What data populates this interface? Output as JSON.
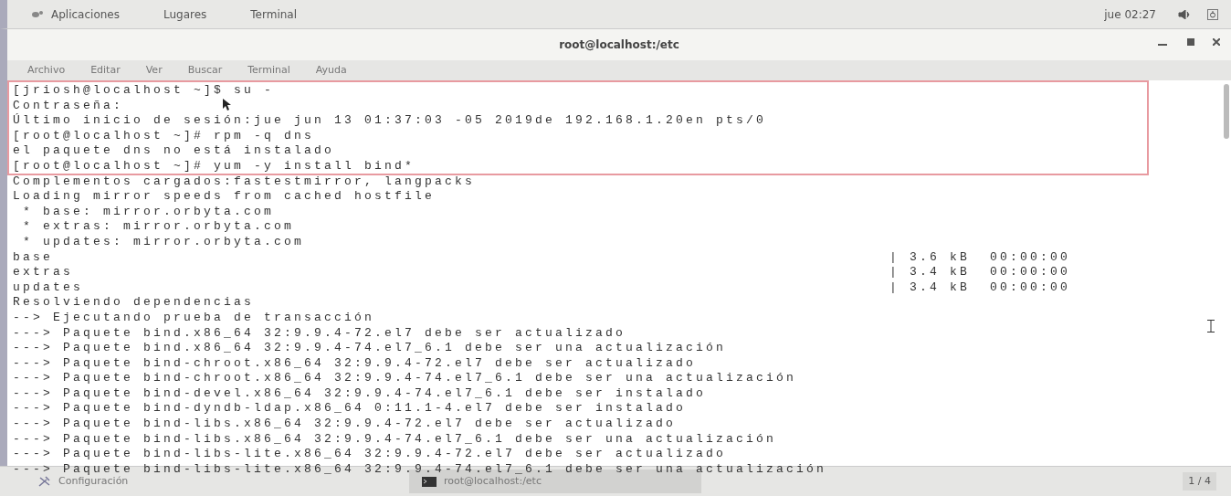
{
  "top_bar": {
    "menus": [
      "Aplicaciones",
      "Lugares",
      "Terminal"
    ],
    "clock": "jue 02:27"
  },
  "window": {
    "title": "root@localhost:/etc"
  },
  "menu_bar": [
    "Archivo",
    "Editar",
    "Ver",
    "Buscar",
    "Terminal",
    "Ayuda"
  ],
  "terminal": {
    "lines": [
      {
        "kind": "text",
        "text": "[jriosh@localhost ~]$ su -"
      },
      {
        "kind": "text",
        "text": "Contraseña:"
      },
      {
        "kind": "text",
        "text": "Último inicio de sesión:jue jun 13 01:37:03 -05 2019de 192.168.1.20en pts/0"
      },
      {
        "kind": "text",
        "text": "[root@localhost ~]# rpm -q dns"
      },
      {
        "kind": "text",
        "text": "el paquete dns no está instalado"
      },
      {
        "kind": "text",
        "text": "[root@localhost ~]# yum -y install bind*"
      },
      {
        "kind": "text",
        "text": "Complementos cargados:fastestmirror, langpacks"
      },
      {
        "kind": "text",
        "text": "Loading mirror speeds from cached hostfile"
      },
      {
        "kind": "text",
        "text": " * base: mirror.orbyta.com"
      },
      {
        "kind": "text",
        "text": " * extras: mirror.orbyta.com"
      },
      {
        "kind": "text",
        "text": " * updates: mirror.orbyta.com"
      },
      {
        "kind": "repo",
        "text": "base",
        "status": "| 3.6 kB  00:00:00"
      },
      {
        "kind": "repo",
        "text": "extras",
        "status": "| 3.4 kB  00:00:00"
      },
      {
        "kind": "repo",
        "text": "updates",
        "status": "| 3.4 kB  00:00:00"
      },
      {
        "kind": "text",
        "text": "Resolviendo dependencias"
      },
      {
        "kind": "text",
        "text": "--> Ejecutando prueba de transacción"
      },
      {
        "kind": "text",
        "text": "---> Paquete bind.x86_64 32:9.9.4-72.el7 debe ser actualizado"
      },
      {
        "kind": "text",
        "text": "---> Paquete bind.x86_64 32:9.9.4-74.el7_6.1 debe ser una actualización"
      },
      {
        "kind": "text",
        "text": "---> Paquete bind-chroot.x86_64 32:9.9.4-72.el7 debe ser actualizado"
      },
      {
        "kind": "text",
        "text": "---> Paquete bind-chroot.x86_64 32:9.9.4-74.el7_6.1 debe ser una actualización"
      },
      {
        "kind": "text",
        "text": "---> Paquete bind-devel.x86_64 32:9.9.4-74.el7_6.1 debe ser instalado"
      },
      {
        "kind": "text",
        "text": "---> Paquete bind-dyndb-ldap.x86_64 0:11.1-4.el7 debe ser instalado"
      },
      {
        "kind": "text",
        "text": "---> Paquete bind-libs.x86_64 32:9.9.4-72.el7 debe ser actualizado"
      },
      {
        "kind": "text",
        "text": "---> Paquete bind-libs.x86_64 32:9.9.4-74.el7_6.1 debe ser una actualización"
      },
      {
        "kind": "text",
        "text": "---> Paquete bind-libs-lite.x86_64 32:9.9.4-72.el7 debe ser actualizado"
      },
      {
        "kind": "text",
        "text": "---> Paquete bind-libs-lite.x86_64 32:9.9.4-74.el7_6.1 debe ser una actualización"
      }
    ]
  },
  "taskbar": {
    "items": [
      {
        "kind": "settings",
        "label": "Configuración",
        "selected": false
      },
      {
        "kind": "terminal",
        "label": "root@localhost:/etc",
        "selected": true
      }
    ],
    "workspace": "1 / 4"
  }
}
